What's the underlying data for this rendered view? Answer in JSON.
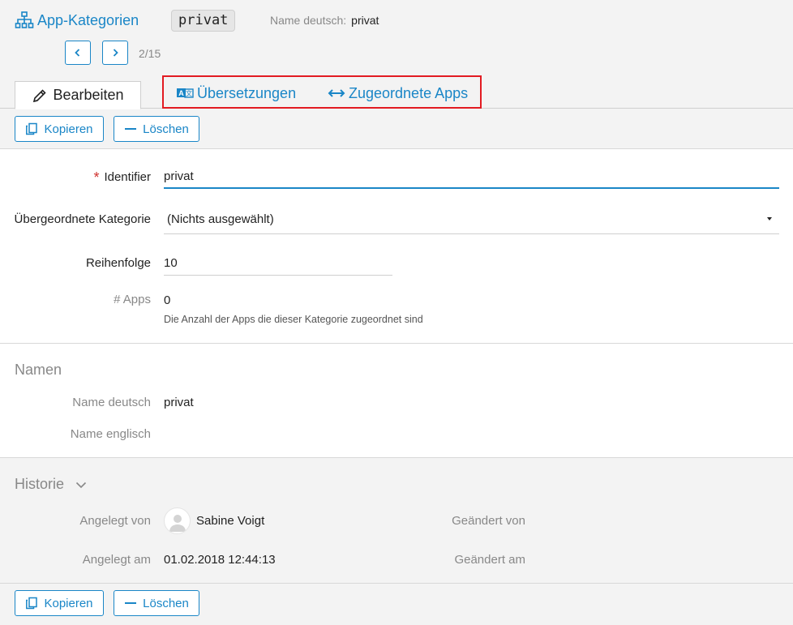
{
  "header": {
    "title": "App-Kategorien",
    "identifier_chip": "privat",
    "name_label": "Name deutsch:",
    "name_value": "privat",
    "pager": "2/15"
  },
  "tabs": [
    {
      "label": "Bearbeiten",
      "icon": "pencil-icon",
      "active": true
    },
    {
      "label": "Übersetzungen",
      "icon": "translate-icon",
      "active": false
    },
    {
      "label": "Zugeordnete Apps",
      "icon": "arrows-left-right-icon",
      "active": false
    }
  ],
  "toolbar": {
    "copy_label": "Kopieren",
    "delete_label": "Löschen"
  },
  "form": {
    "identifier_label": "Identifier",
    "identifier_required_mark": "*",
    "identifier_value": "privat",
    "parent_label": "Übergeordnete Kategorie",
    "parent_value": "(Nichts ausgewählt)",
    "order_label": "Reihenfolge",
    "order_value": "10",
    "apps_label": "# Apps",
    "apps_value": "0",
    "apps_hint": "Die Anzahl der Apps die dieser Kategorie zugeordnet sind"
  },
  "names": {
    "section_title": "Namen",
    "de_label": "Name deutsch",
    "de_value": "privat",
    "en_label": "Name englisch",
    "en_value": ""
  },
  "history": {
    "section_title": "Historie",
    "created_by_label": "Angelegt von",
    "created_by_value": "Sabine Voigt",
    "created_at_label": "Angelegt am",
    "created_at_value": "01.02.2018 12:44:13",
    "changed_by_label": "Geändert von",
    "changed_at_label": "Geändert am"
  },
  "colors": {
    "accent": "#1a86c7",
    "highlight": "#e21b22",
    "required": "#d0322e"
  }
}
